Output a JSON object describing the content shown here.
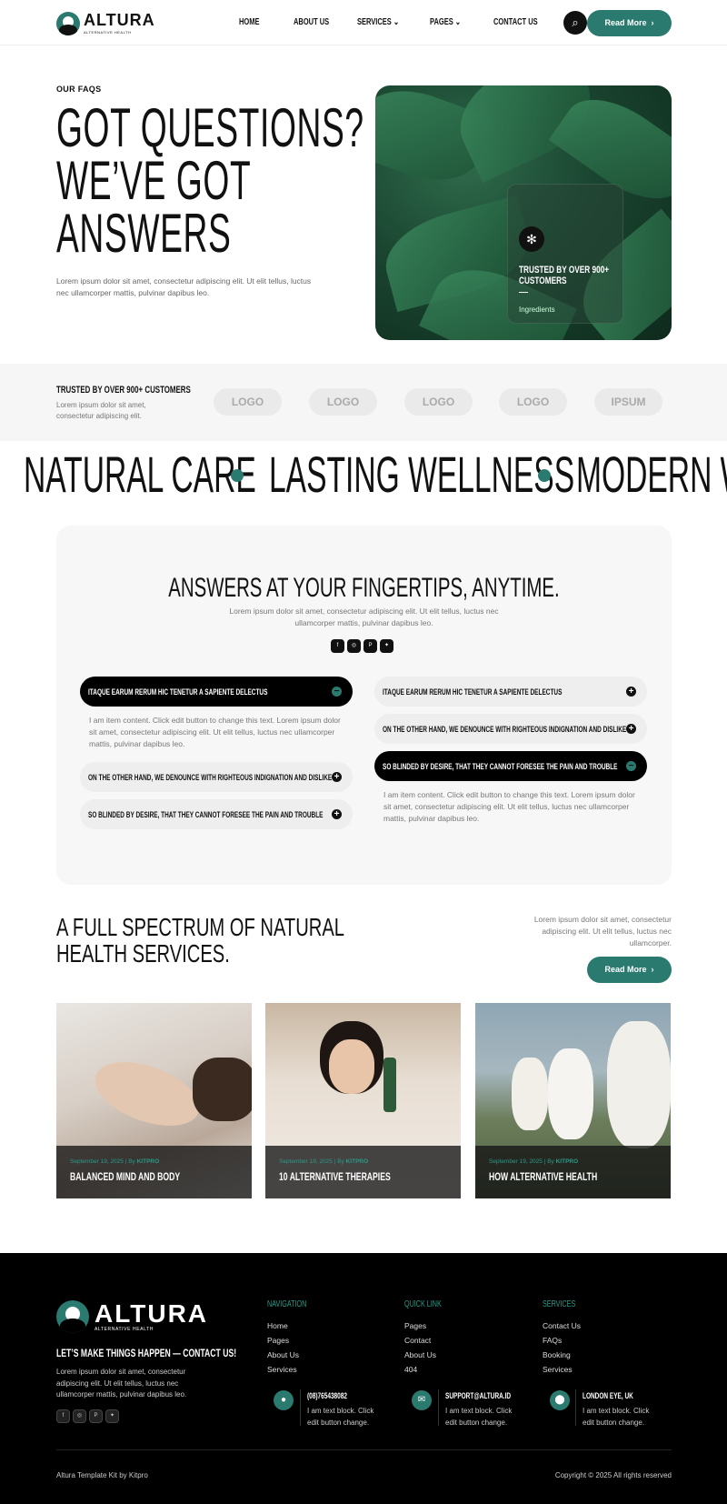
{
  "header": {
    "logo_name": "ALTURA",
    "logo_sub": "ALTERNATIVE HEALTH",
    "nav": [
      "HOME",
      "ABOUT US",
      "SERVICES",
      "PAGES",
      "CONTACT US"
    ],
    "cta": "Read More"
  },
  "hero": {
    "label": "OUR FAQS",
    "title_line1": "GOT QUESTIONS?",
    "title_line2": "WE’VE GOT",
    "title_line3": "ANSWERS",
    "text": "Lorem ipsum dolor sit amet, consectetur adipiscing elit. Ut elit tellus, luctus nec ullamcorper mattis, pulvinar dapibus leo.",
    "card_title": "TRUSTED BY OVER 900+ CUSTOMERS",
    "card_sub": "Ingredients"
  },
  "clients": {
    "title": "TRUSTED BY OVER 900+ CUSTOMERS",
    "text": "Lorem ipsum dolor sit amet, consectetur adipiscing elit.",
    "logos": [
      "LOGO",
      "LOGO",
      "LOGO",
      "LOGO",
      "IPSUM"
    ]
  },
  "marquee": [
    "NATURAL CARE",
    "LASTING WELLNESS",
    "MODERN WE"
  ],
  "faq": {
    "title": "ANSWERS AT YOUR FINGERTIPS, ANYTIME.",
    "text": "Lorem ipsum dolor sit amet, consectetur adipiscing elit. Ut elit tellus, luctus nec ullamcorper mattis, pulvinar dapibus leo.",
    "left": [
      {
        "q": "ITAQUE EARUM RERUM HIC TENETUR A SAPIENTE DELECTUS",
        "open": true
      },
      {
        "q": "ON THE OTHER HAND, WE DENOUNCE WITH RIGHTEOUS INDIGNATION AND DISLIKE",
        "open": false
      },
      {
        "q": "SO BLINDED BY DESIRE, THAT THEY CANNOT FORESEE THE PAIN AND TROUBLE",
        "open": false
      }
    ],
    "right": [
      {
        "q": "ITAQUE EARUM RERUM HIC TENETUR A SAPIENTE DELECTUS",
        "open": false
      },
      {
        "q": "ON THE OTHER HAND, WE DENOUNCE WITH RIGHTEOUS INDIGNATION AND DISLIKE",
        "open": false
      },
      {
        "q": "SO BLINDED BY DESIRE, THAT THEY CANNOT FORESEE THE PAIN AND TROUBLE",
        "open": true
      }
    ],
    "answer": "I am item content. Click edit button to change this text. Lorem ipsum dolor sit amet, consectetur adipiscing elit. Ut elit tellus, luctus nec ullamcorper mattis, pulvinar dapibus leo."
  },
  "services": {
    "title_line1": "A FULL SPECTRUM OF NATURAL",
    "title_line2": "HEALTH SERVICES.",
    "text": "Lorem ipsum dolor sit amet, consectetur adipiscing elit. Ut elit tellus, luctus nec ullamcorper.",
    "cta": "Read More",
    "cards": [
      {
        "date": "September 19, 2025 | By",
        "author": "KITPRO",
        "title": "BALANCED MIND AND BODY"
      },
      {
        "date": "September 19, 2025 | By",
        "author": "KITPRO",
        "title": "10 ALTERNATIVE THERAPIES"
      },
      {
        "date": "September 19, 2025 | By",
        "author": "KITPRO",
        "title": "HOW ALTERNATIVE HEALTH"
      }
    ]
  },
  "footer": {
    "logo_name": "ALTURA",
    "logo_sub": "ALTERNATIVE HEALTH",
    "tagline": "LET’S MAKE THINGS HAPPEN — CONTACT US!",
    "text": "Lorem ipsum dolor sit amet, consectetur adipiscing elit. Ut elit tellus, luctus nec ullamcorper mattis, pulvinar dapibus leo.",
    "nav_head": "NAVIGATION",
    "nav": [
      "Home",
      "Pages",
      "About Us",
      "Services"
    ],
    "quick_head": "QUICK LINK",
    "quick": [
      "Pages",
      "Contact",
      "About Us",
      "404"
    ],
    "svc_head": "SERVICES",
    "svc": [
      "Contact Us",
      "FAQs",
      "Booking",
      "Services"
    ],
    "contacts": [
      {
        "title": "(08)765438082",
        "text": "I am text block. Click edit button  change."
      },
      {
        "title": "SUPPORT@ALTURA.ID",
        "text": "I am text block. Click edit button  change."
      },
      {
        "title": "LONDON EYE, UK",
        "text": "I am text block. Click edit button  change."
      }
    ],
    "credit": "Altura Template Kit by Kitpro",
    "copyright": "Copyright © 2025 All rights reserved"
  }
}
